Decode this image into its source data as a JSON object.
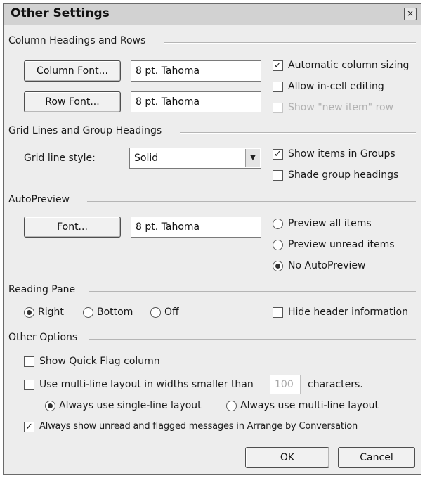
{
  "window": {
    "title": "Other Settings",
    "close_glyph": "×"
  },
  "sections": {
    "column": "Column Headings and Rows",
    "grid": "Grid Lines and Group Headings",
    "autopreview": "AutoPreview",
    "reading": "Reading Pane",
    "other": "Other Options"
  },
  "column": {
    "column_font_btn": "Column Font...",
    "column_font_value": "8 pt. Tahoma",
    "row_font_btn": "Row Font...",
    "row_font_value": "8 pt. Tahoma",
    "auto_sizing": "Automatic column sizing",
    "in_cell_editing": "Allow in-cell editing",
    "new_item_row": "Show \"new item\" row"
  },
  "grid": {
    "style_label": "Grid line style:",
    "style_value": "Solid",
    "show_in_groups": "Show items in Groups",
    "shade_headings": "Shade group headings"
  },
  "autopreview": {
    "font_btn": "Font...",
    "font_value": "8 pt. Tahoma",
    "preview_all": "Preview all items",
    "preview_unread": "Preview unread items",
    "no_preview": "No AutoPreview"
  },
  "reading": {
    "right": "Right",
    "bottom": "Bottom",
    "off": "Off",
    "hide_header": "Hide header information"
  },
  "other": {
    "quick_flag": "Show Quick Flag column",
    "multiline_prefix": "Use multi-line layout in widths smaller than",
    "multiline_value": "100",
    "multiline_suffix": "characters.",
    "single_line": "Always use single-line layout",
    "multi_line": "Always use multi-line layout",
    "unread_flagged": "Always show unread and flagged messages in Arrange by Conversation"
  },
  "footer": {
    "ok": "OK",
    "cancel": "Cancel"
  },
  "state": {
    "auto_sizing": true,
    "in_cell_editing": false,
    "new_item_row": false,
    "show_in_groups": true,
    "shade_headings": false,
    "autopreview_mode": "No AutoPreview",
    "reading_pane": "Right",
    "hide_header": false,
    "quick_flag": false,
    "multiline": false,
    "layout_mode": "Always use single-line layout",
    "unread_flagged": true
  }
}
